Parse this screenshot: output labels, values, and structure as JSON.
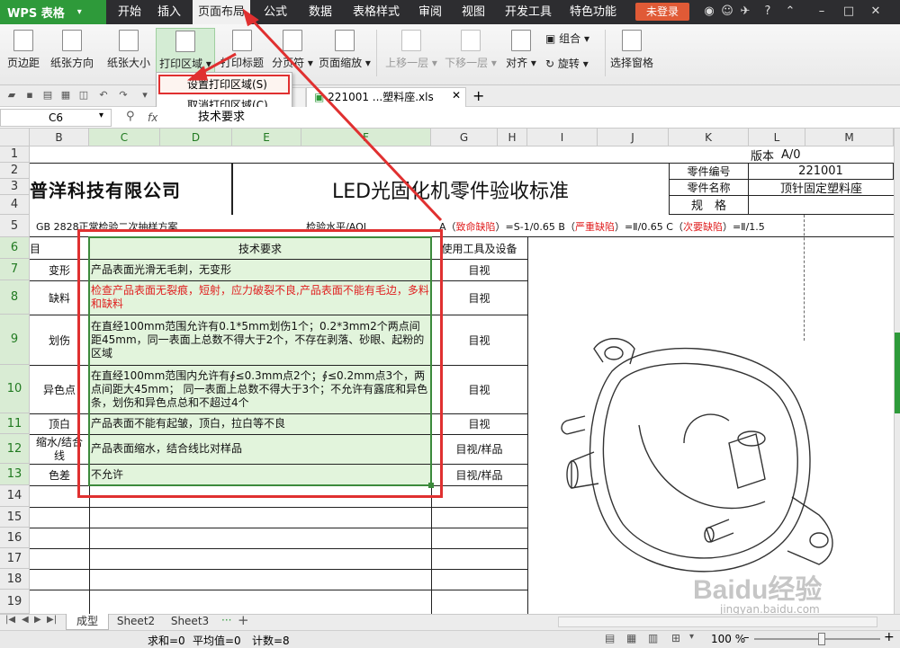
{
  "app": {
    "logo": "WPS 表格",
    "menu": [
      "开始",
      "插入",
      "页面布局",
      "公式",
      "数据",
      "表格样式",
      "审阅",
      "视图",
      "开发工具",
      "特色功能"
    ],
    "active_menu": "页面布局",
    "login": "未登录"
  },
  "ribbon": {
    "buttons": [
      "页边距",
      "纸张方向",
      "纸张大小",
      "打印区域",
      "打印标题",
      "分页符",
      "页面缩放",
      "上移一层",
      "下移一层",
      "对齐",
      "组合",
      "旋转",
      "选择窗格"
    ]
  },
  "dropdown": {
    "set_print_area": "设置打印区域(S)",
    "cancel_print_area": "取消打印区域(C)"
  },
  "file_tab": "221001 ...塑料座.xls",
  "formula_bar": {
    "cell_ref": "C6",
    "fx": "fx",
    "value": "技术要求"
  },
  "columns": [
    "B",
    "C",
    "D",
    "E",
    "F",
    "G",
    "H",
    "I",
    "J",
    "K",
    "L",
    "M"
  ],
  "rows": [
    "1",
    "2",
    "3",
    "4",
    "5",
    "6",
    "7",
    "8",
    "9",
    "10",
    "11",
    "12",
    "13",
    "14",
    "15",
    "16",
    "17",
    "18",
    "19"
  ],
  "sheet": {
    "company": "普洋科技有限公司",
    "title": "LED光固化机零件验收标准",
    "version_label": "版本",
    "version": "A/0",
    "part_no_label": "零件编号",
    "part_no": "221001",
    "part_name_label": "零件名称",
    "part_name": "顶针固定塑料座",
    "spec_label": "规　格",
    "row5_gb": "GB 2828正常检验二次抽样方案",
    "row5_aql": "检验水平/AQL",
    "row5_a": "A（",
    "row5_fatal": "致命缺陷",
    "row5_a2": "）=S-1/0.65  B（",
    "row5_major": "严重缺陷",
    "row5_b2": "）=Ⅱ/0.65  C（",
    "row5_minor": "次要缺陷",
    "row5_c2": "）=Ⅱ/1.5",
    "hdr_item": "目",
    "hdr_req": "技术要求",
    "hdr_tool": "使用工具及设备",
    "items": [
      {
        "name": "变形",
        "req": "产品表面光滑无毛刺，无变形",
        "tool": "目视",
        "red": false
      },
      {
        "name": "缺料",
        "req": "检查产品表面无裂痕，短射，应力破裂不良,产品表面不能有毛边，多料和缺料",
        "tool": "目视",
        "red": true
      },
      {
        "name": "划伤",
        "req": "在直经100mm范围允许有0.1*5mm划伤1个；0.2*3mm2个两点间距45mm，同一表面上总数不得大于2个，不存在剥落、砂眼、起粉的区域",
        "tool": "目视",
        "red": false
      },
      {
        "name": "异色点",
        "req": "在直经100mm范围内允许有∮≤0.3mm点2个；∮≤0.2mm点3个，两点间距大45mm； 同一表面上总数不得大于3个；不允许有露底和异色条，划伤和异色点总和不超过4个",
        "tool": "目视",
        "red": false
      },
      {
        "name": "顶白",
        "req": "产品表面不能有起皱，顶白，拉白等不良",
        "tool": "目视",
        "red": false
      },
      {
        "name": "缩水/结合线",
        "req": "产品表面缩水，结合线比对样品",
        "tool": "目视/样品",
        "red": false
      },
      {
        "name": "色差",
        "req": "不允许",
        "tool": "目视/样品",
        "red": false
      }
    ]
  },
  "sheet_tabs": [
    "成型",
    "Sheet2",
    "Sheet3"
  ],
  "status": {
    "sum": "求和=0",
    "avg": "平均值=0",
    "count": "计数=8",
    "zoom": "100 %"
  },
  "watermark": "Baidu经验",
  "watermark_url": "jingyan.baidu.com",
  "colors": {
    "accent_green": "#2e9a3a",
    "highlight_red": "#e03030",
    "login_orange": "#e05a36",
    "selection_green": "#e2f4dc"
  }
}
